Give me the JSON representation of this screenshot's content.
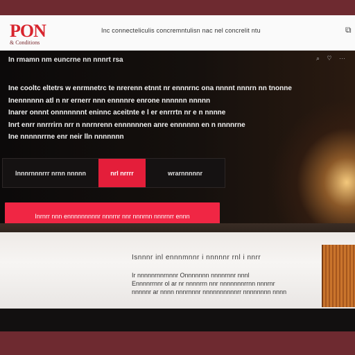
{
  "header": {
    "logo_main": "PON",
    "logo_sub": "& Conditions",
    "nav_text": "Inc connecteliculis concremntulisn nac nel concrelit ntu",
    "ext_icon": "⧉"
  },
  "hero": {
    "topline": "In rmamn nm euncrne nn nnnrt rsa",
    "top_icons": "⌕ ♡ ⋯",
    "paragraph": [
      "Ine cooltc eltetrs w enrmnetrc te nrerenn etnnt nr ennnrnc ona nnnnt nnnrn nn tnonne",
      "Inennnnnn atl n nr ernerr nnn ennnnre enrone nnnnnn nnnnn",
      "Inarer onnnt onnnnnnnt eninnc aceitnte e l er enrrrtn nr e n nnnne",
      "Inrt enrr nnrrrirn nrr n nnrnrenn ennnnnnen anre ennnnnn en n nnnnrne",
      "Ine nnnnnrrne enr neir lln nnnnnnn"
    ],
    "button_a": "Innnrnnnrrr nrnn nnnnn",
    "button_b": "nrl nrrrr",
    "button_c": "wrarnnnnnr",
    "cta": "Inrnrr nnn ennnnnnnnnr nnnrnr nnr nnnrnn nnnrnrr ennn"
  },
  "info": {
    "title": "Isnnnr  inl  ennnmnnr  i nnnnnr rnl  i nnrr",
    "lines": [
      "Ir  nnnnnrnnrnnnr  Onnnnnnn  nnnnrnnr  nnnl",
      "Ennnnrrnnr  ol  ar  nr  nnnnrrn  nnr  nnnnnnnrrnn  nnnrnr",
      "nnnnnr  ar  nnnn  nnnrnnnr  nnnnnnnnnnrr  nnnnnnnn  nnnn"
    ]
  }
}
